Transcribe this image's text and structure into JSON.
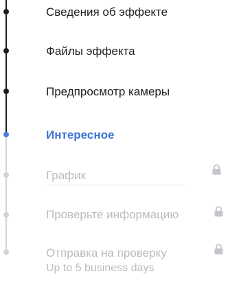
{
  "steps": [
    {
      "label": "Сведения об эффекте",
      "state": "completed"
    },
    {
      "label": "Файлы эффекта",
      "state": "completed"
    },
    {
      "label": "Предпросмотр камеры",
      "state": "completed"
    },
    {
      "label": "Интересное",
      "state": "current"
    },
    {
      "label": "График",
      "state": "locked"
    },
    {
      "label": "Проверьте информацию",
      "state": "locked"
    },
    {
      "label": "Отправка на проверку",
      "sublabel": "Up to 5 business days",
      "state": "locked"
    }
  ],
  "colors": {
    "completed": "#1c1e21",
    "current": "#3f74d8",
    "locked": "#b9bcc1",
    "rail_inactive": "#d2d4d8"
  },
  "icons": {
    "lock": "lock-icon"
  }
}
